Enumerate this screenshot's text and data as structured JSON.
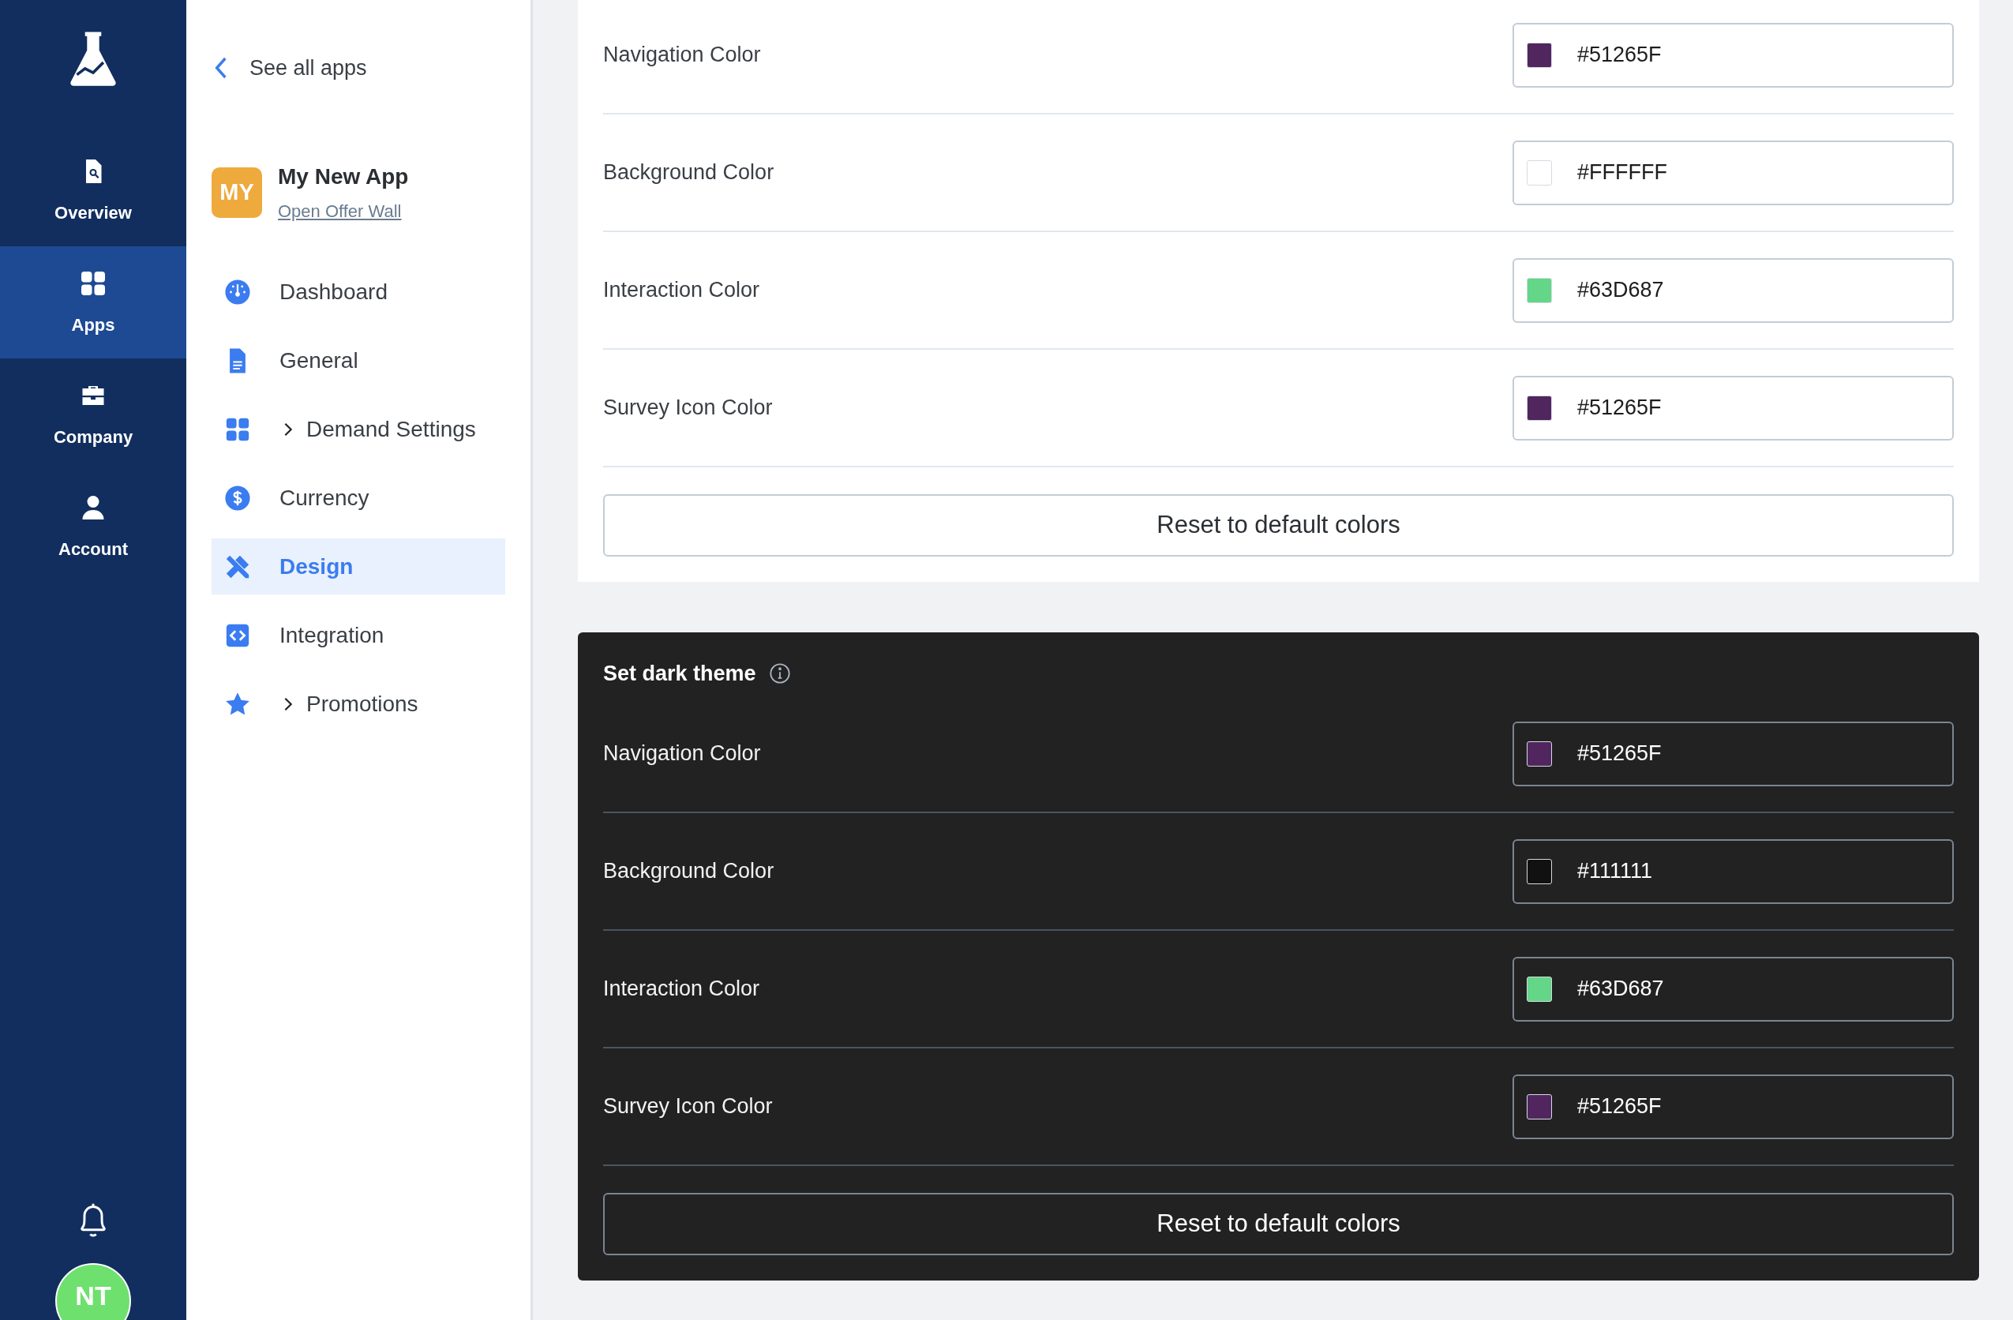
{
  "rail": {
    "items": [
      {
        "label": "Overview",
        "selected": false
      },
      {
        "label": "Apps",
        "selected": true
      },
      {
        "label": "Company",
        "selected": false
      },
      {
        "label": "Account",
        "selected": false
      }
    ],
    "avatar": "NT"
  },
  "sidebar": {
    "back_link": "See all apps",
    "app": {
      "initials": "MY",
      "name": "My New App",
      "link": "Open Offer Wall"
    },
    "items": [
      {
        "label": "Dashboard",
        "kind": "link",
        "selected": false
      },
      {
        "label": "General",
        "kind": "link",
        "selected": false
      },
      {
        "label": "Demand Settings",
        "kind": "group",
        "selected": false
      },
      {
        "label": "Currency",
        "kind": "link",
        "selected": false
      },
      {
        "label": "Design",
        "kind": "link",
        "selected": true
      },
      {
        "label": "Integration",
        "kind": "link",
        "selected": false
      },
      {
        "label": "Promotions",
        "kind": "group",
        "selected": false
      }
    ]
  },
  "sections": [
    {
      "kind": "light",
      "rows": [
        {
          "label": "Navigation Color",
          "value": "#51265F",
          "color": "#51265f"
        },
        {
          "label": "Background Color",
          "value": "#FFFFFF",
          "color": "#ffffff"
        },
        {
          "label": "Interaction Color",
          "value": "#63D687",
          "color": "#63d687"
        },
        {
          "label": "Survey Icon Color",
          "value": "#51265F",
          "color": "#51265f"
        }
      ],
      "reset_button": "Reset to default colors"
    },
    {
      "kind": "dark",
      "title": "Set dark theme",
      "rows": [
        {
          "label": "Navigation Color",
          "value": "#51265F",
          "color": "#51265f"
        },
        {
          "label": "Background Color",
          "value": "#111111",
          "color": "#111111"
        },
        {
          "label": "Interaction Color",
          "value": "#63D687",
          "color": "#63d687"
        },
        {
          "label": "Survey Icon Color",
          "value": "#51265F",
          "color": "#51265f"
        }
      ],
      "reset_button": "Reset to default colors"
    }
  ]
}
